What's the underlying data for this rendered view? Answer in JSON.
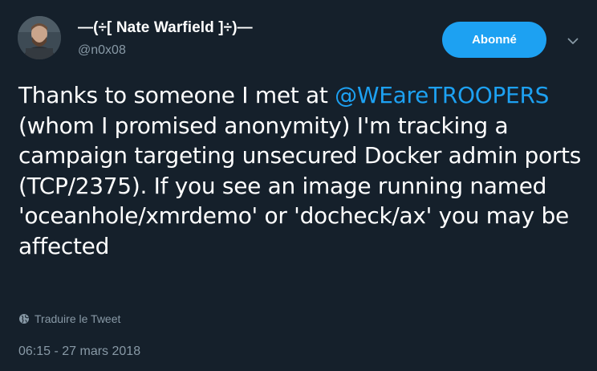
{
  "author": {
    "display_name": "—(÷[ Nate Warfield ]÷)—",
    "handle": "@n0x08"
  },
  "follow_button": {
    "label": "Abonné"
  },
  "tweet": {
    "text_before_mention": "Thanks to someone I met at ",
    "mention": "@WEareTROOPERS",
    "text_after_mention": " (whom I promised anonymity) I'm tracking a campaign targeting unsecured Docker admin ports (TCP/2375). If you see an image running named 'oceanhole/xmrdemo' or 'docheck/ax' you may be affected"
  },
  "translate_label": "Traduire le Tweet",
  "timestamp": "06:15 - 27 mars 2018",
  "colors": {
    "background": "#15202b",
    "accent": "#1da1f2",
    "secondary_text": "#8899a6"
  },
  "icons": {
    "menu": "chevron-down-icon",
    "translate": "globe-icon"
  }
}
